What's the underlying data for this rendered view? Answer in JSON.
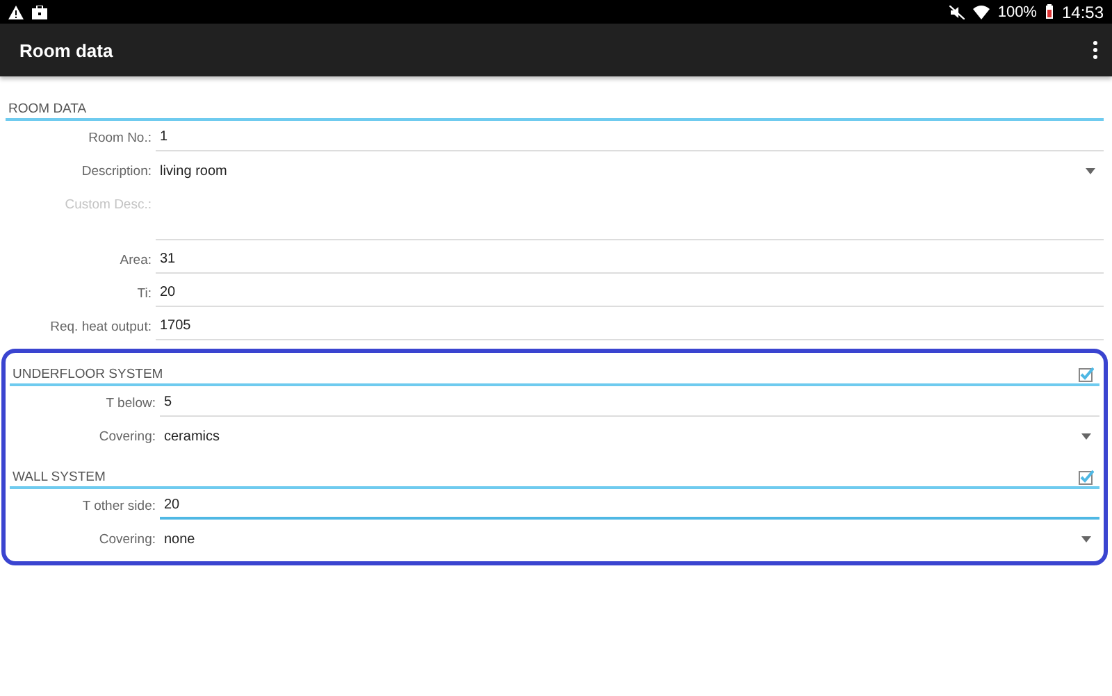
{
  "status_bar": {
    "battery": "100%",
    "time": "14:53"
  },
  "app_bar": {
    "title": "Room data"
  },
  "sections": [
    {
      "title": "ROOM DATA",
      "fields": [
        {
          "label": "Room No.:",
          "kind": "text",
          "value": "1",
          "focused": false,
          "disabled": false
        },
        {
          "label": "Description:",
          "kind": "dropdown",
          "value": "living room",
          "disabled": false
        },
        {
          "label": "Custom Desc.:",
          "kind": "multiline",
          "focused": false,
          "disabled": true
        },
        {
          "label": "Area:",
          "kind": "text",
          "value": "31",
          "focused": false,
          "disabled": false
        },
        {
          "label": "Ti:",
          "kind": "text",
          "value": "20",
          "focused": false,
          "disabled": false
        },
        {
          "label": "Req. heat output:",
          "kind": "text",
          "value": "1705",
          "focused": false,
          "disabled": false
        }
      ]
    }
  ],
  "highlighted_group": {
    "sections": [
      {
        "title": "UNDERFLOOR SYSTEM",
        "checked": true,
        "fields": [
          {
            "label": "T below:",
            "kind": "text",
            "value": "5",
            "focused": false,
            "disabled": false
          },
          {
            "label": "Covering:",
            "kind": "dropdown",
            "value": "ceramics",
            "disabled": false
          }
        ]
      },
      {
        "title": "WALL SYSTEM",
        "checked": true,
        "fields": [
          {
            "label": "T other side:",
            "kind": "text",
            "value": "20",
            "focused": true,
            "disabled": false
          },
          {
            "label": "Covering:",
            "kind": "dropdown",
            "value": "none",
            "disabled": false
          }
        ]
      }
    ]
  }
}
